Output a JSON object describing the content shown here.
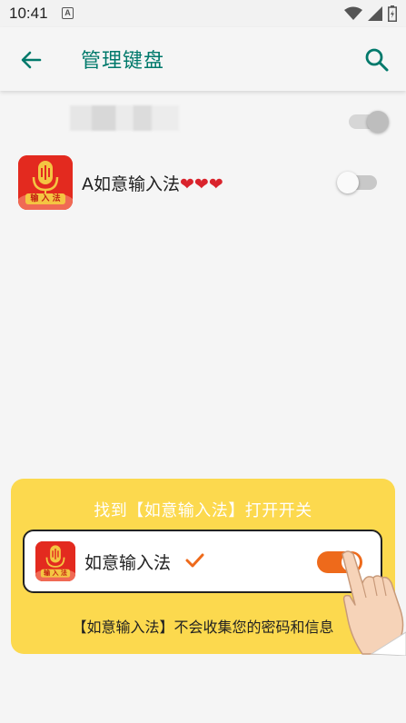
{
  "status_bar": {
    "time": "10:41",
    "a_icon_letter": "A"
  },
  "app_bar": {
    "title": "管理键盘",
    "back_icon": "arrow-back-icon",
    "search_icon": "search-icon"
  },
  "keyboards": [
    {
      "label": "",
      "blurred": true,
      "enabled": true,
      "disabled": true
    },
    {
      "label": "A如意输入法",
      "hearts": "❤❤❤",
      "enabled": false,
      "disabled": false
    }
  ],
  "app_icon": {
    "banner_text": "输 入 法",
    "brand_color": "#e32a1f"
  },
  "guide": {
    "title": "找到【如意输入法】打开开关",
    "item_label": "如意输入法",
    "toggle_on": true,
    "footer": "【如意输入法】不会收集您的密码和信息",
    "card_color": "#fcd94e",
    "accent_color": "#ee6a1b"
  },
  "colors": {
    "teal": "#00796b",
    "background": "#f5f5f5"
  }
}
